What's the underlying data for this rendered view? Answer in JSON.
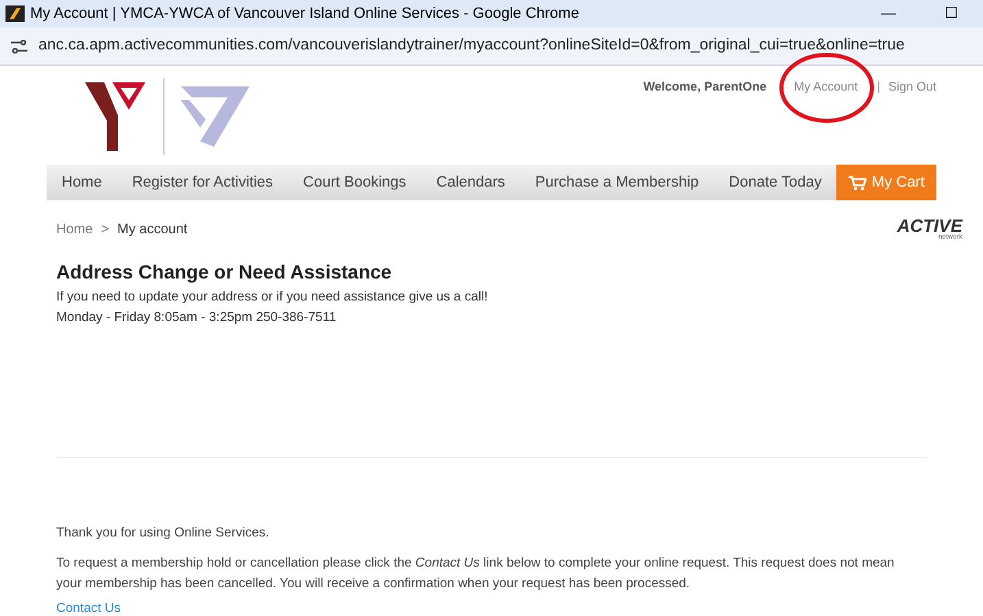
{
  "window": {
    "title": "My Account | YMCA-YWCA of Vancouver Island Online Services - Google Chrome",
    "controls": [
      "—",
      "☐"
    ]
  },
  "address_bar": {
    "url": "anc.ca.apm.activecommunities.com/vancouverislandytrainer/myaccount?onlineSiteId=0&from_original_cui=true&online=true"
  },
  "header": {
    "welcome": "Welcome, ParentOne",
    "links": [
      "My Account",
      "Sign Out"
    ],
    "separator": "|"
  },
  "nav": {
    "items": [
      "Home",
      "Register for Activities",
      "Court Bookings",
      "Calendars",
      "Purchase a Membership",
      "Donate Today"
    ],
    "cart": "My Cart"
  },
  "breadcrumb": {
    "items": [
      "Home",
      "My account"
    ],
    "separator": ">"
  },
  "brand": {
    "logo_text": "ACTIVE",
    "sub": "network"
  },
  "notice": {
    "title": "Address Change or Need Assistance",
    "lines": [
      "If you need to update your address or if you need assistance give us a call!",
      "Monday - Friday 8:05am - 3:25pm 250-386-7511"
    ]
  },
  "footer": {
    "thanks": "Thank you for using Online Services.",
    "request": "To request a membership hold or cancellation please click the *Contact Us* link below to complete your online request. This request does not mean your membership has been cancelled. You will receive a confirmation when your request has been processed.",
    "link": "Contact Us"
  }
}
